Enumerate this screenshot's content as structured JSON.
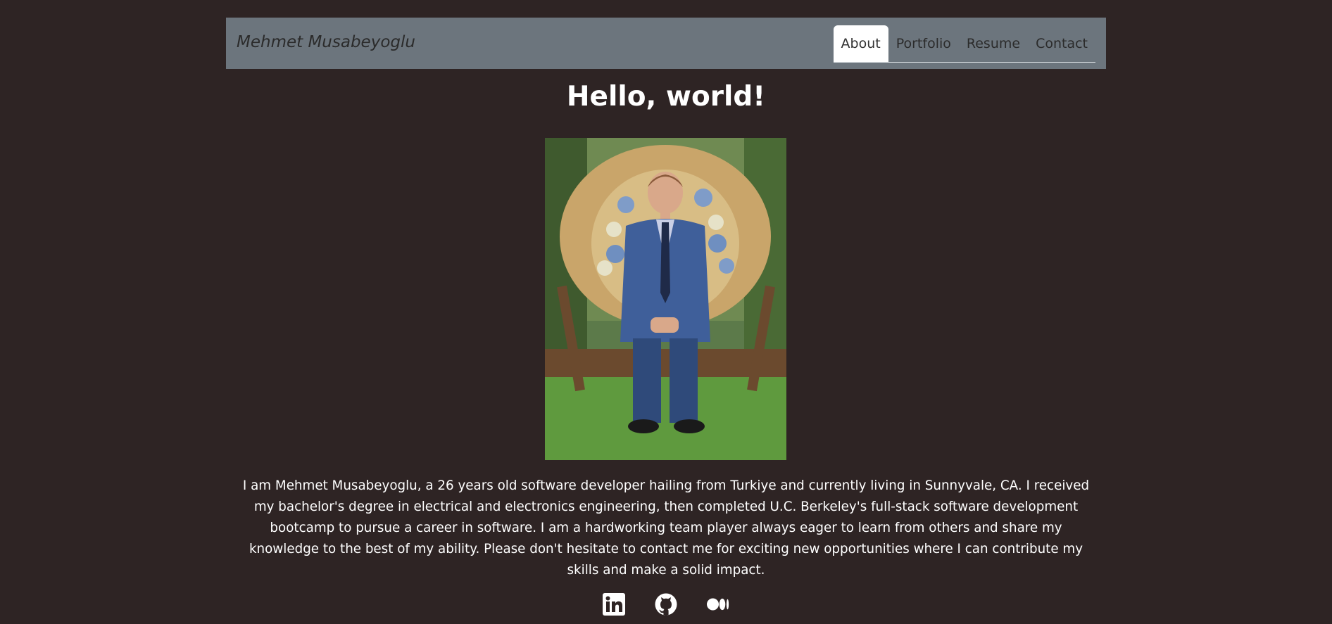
{
  "navbar": {
    "brand": "Mehmet Musabeyoglu",
    "links": [
      {
        "label": "About",
        "active": true
      },
      {
        "label": "Portfolio",
        "active": false
      },
      {
        "label": "Resume",
        "active": false
      },
      {
        "label": "Contact",
        "active": false
      }
    ]
  },
  "hero": {
    "title": "Hello, world!"
  },
  "bio": {
    "text": "I am Mehmet Musabeyoglu, a 26 years old software developer hailing from Turkiye and currently living in Sunnyvale, CA. I received my bachelor's degree in electrical and electronics engineering, then completed U.C. Berkeley's full-stack software development bootcamp to pursue a career in software. I am a hardworking team player always eager to learn from others and share my knowledge to the best of my ability. Please don't hesitate to contact me for exciting new opportunities where I can contribute my skills and make a solid impact."
  },
  "social": [
    {
      "icon": "linkedin-icon"
    },
    {
      "icon": "github-icon"
    },
    {
      "icon": "medium-icon"
    }
  ],
  "colors": {
    "background": "#2e2424",
    "navbar": "#6c757d",
    "text": "#ffffff"
  }
}
